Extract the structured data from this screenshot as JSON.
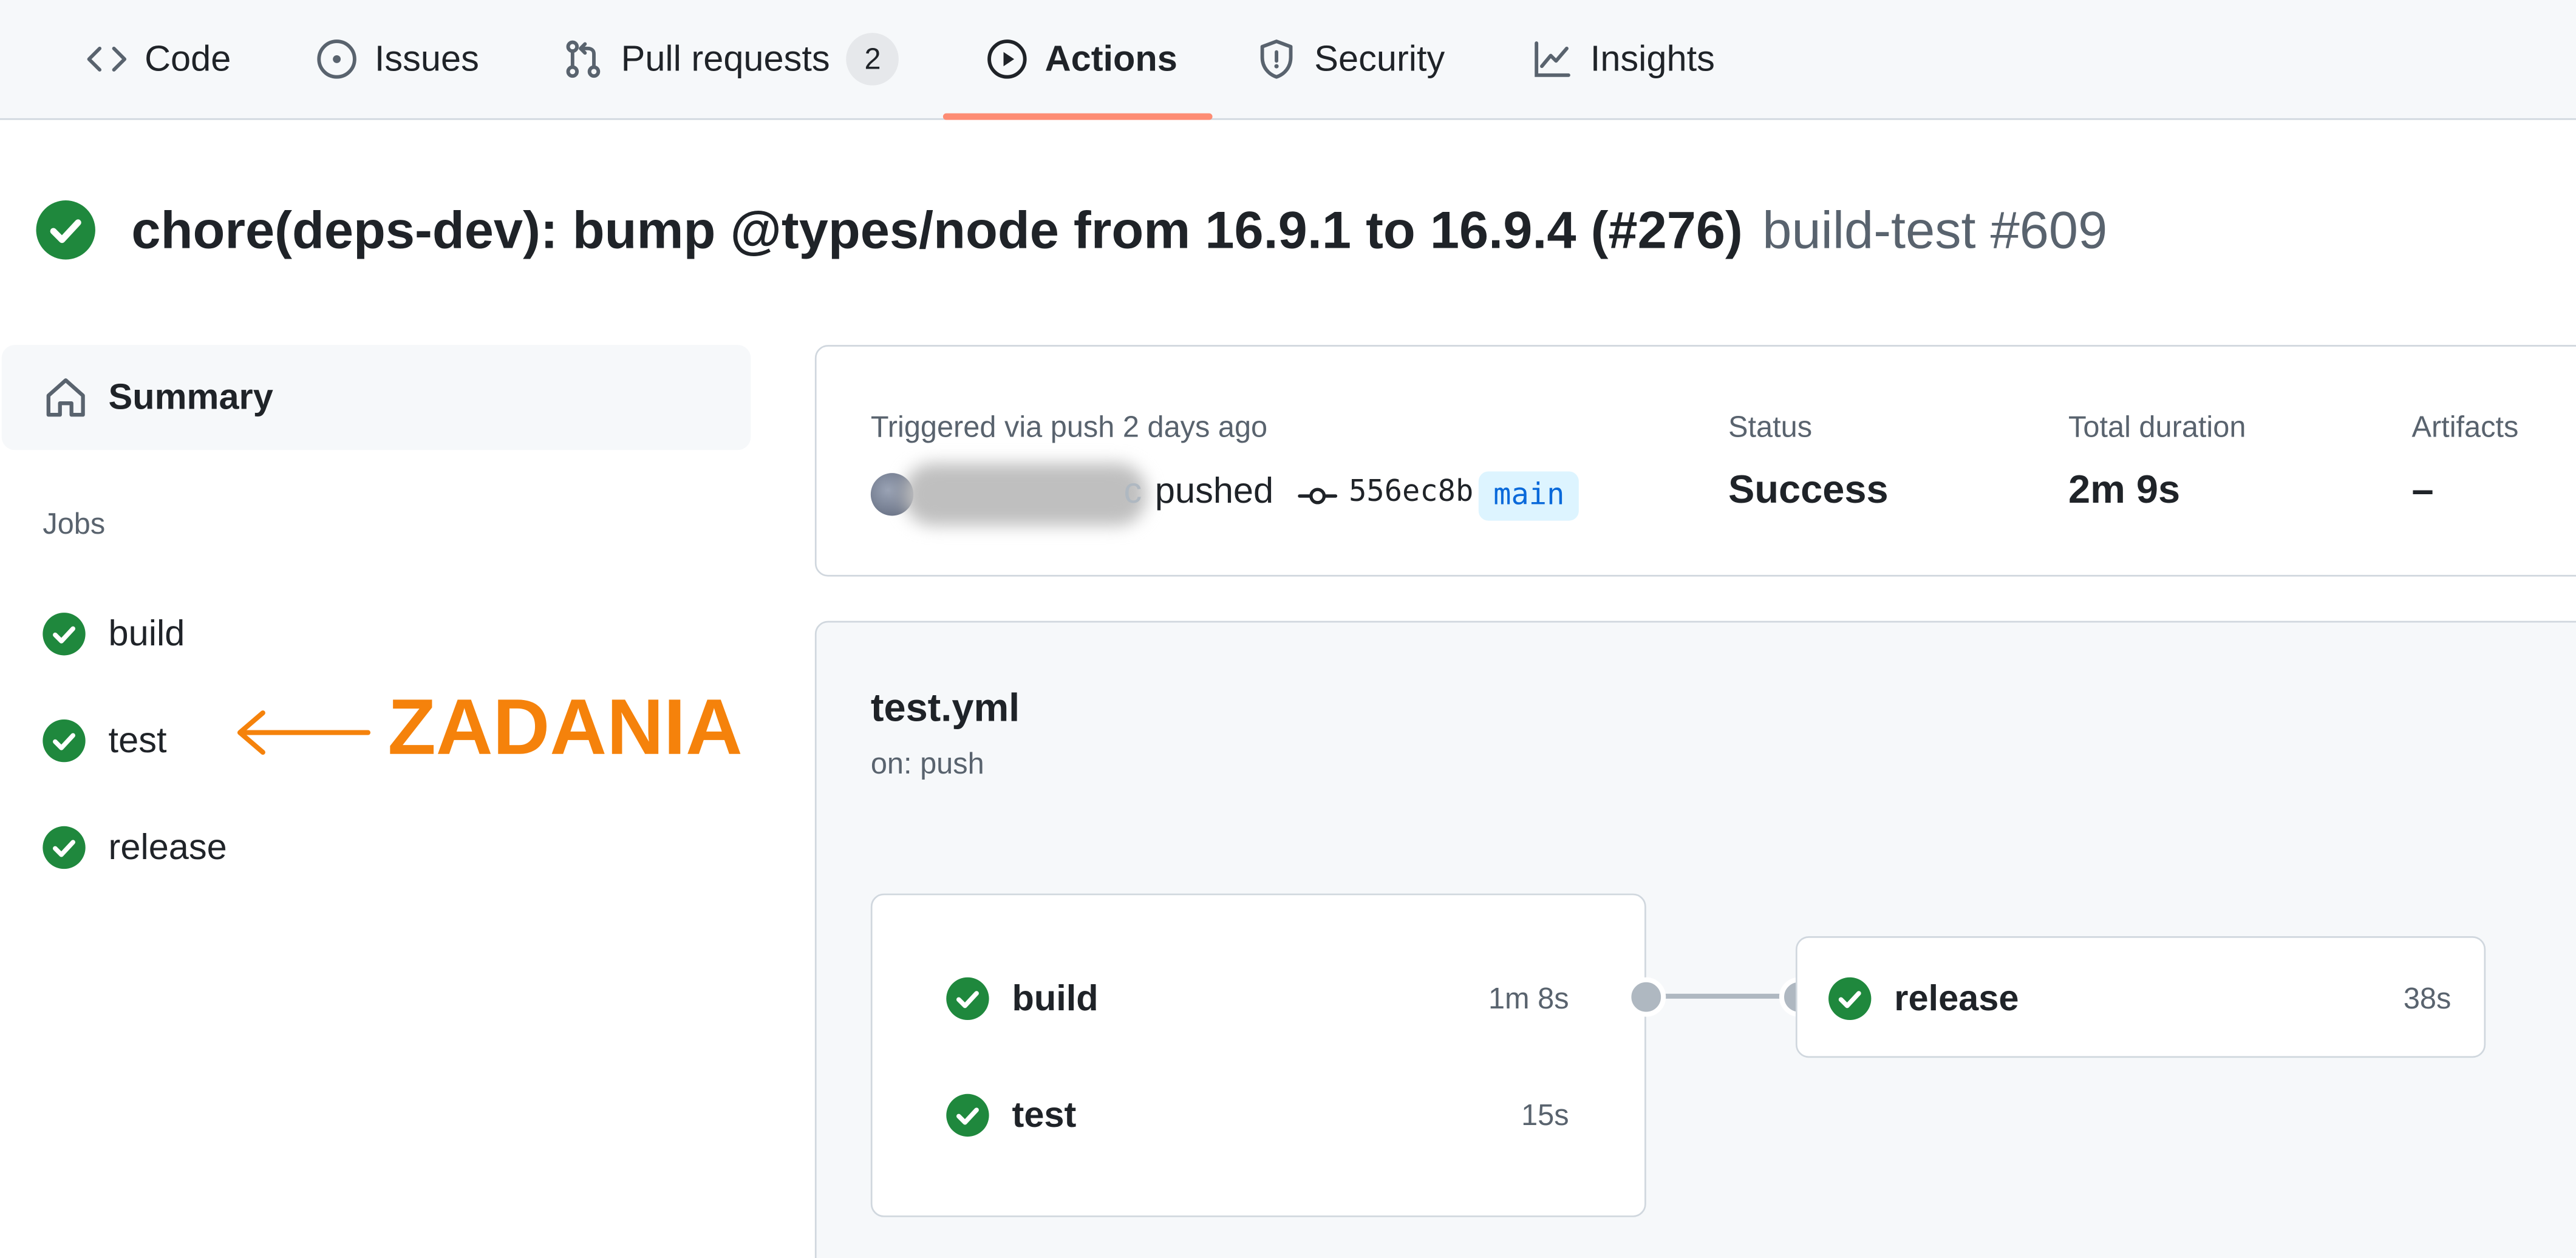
{
  "nav": {
    "tabs": [
      {
        "label": "Code",
        "icon": "code-icon"
      },
      {
        "label": "Issues",
        "icon": "issue-opened-icon"
      },
      {
        "label": "Pull requests",
        "icon": "git-pull-request-icon",
        "count": "2"
      },
      {
        "label": "Actions",
        "icon": "play-icon",
        "active": true
      },
      {
        "label": "Security",
        "icon": "shield-icon"
      },
      {
        "label": "Insights",
        "icon": "graph-icon"
      }
    ]
  },
  "run": {
    "title": "chore(deps-dev): bump @types/node from 16.9.1 to 16.9.4 (#276)",
    "suffix": "build-test #609",
    "status_icon": "check-circle-icon"
  },
  "sidebar": {
    "summary_label": "Summary",
    "summary_icon": "home-icon",
    "jobs_heading": "Jobs",
    "jobs": [
      {
        "label": "build"
      },
      {
        "label": "test"
      },
      {
        "label": "release"
      }
    ]
  },
  "annotation": {
    "text": "ZADANIA",
    "color": "#f5820b"
  },
  "summary": {
    "triggered_text": "Triggered via push 2 days ago",
    "actor_suffix": "c",
    "pushed_text": "pushed",
    "commit_sha": "556ec8b",
    "branch": "main",
    "status_label": "Status",
    "status_value": "Success",
    "duration_label": "Total duration",
    "duration_value": "2m 9s",
    "artifacts_label": "Artifacts",
    "artifacts_value": "–"
  },
  "workflow": {
    "file": "test.yml",
    "trigger": "on: push",
    "group_jobs": [
      {
        "name": "build",
        "duration": "1m 8s"
      },
      {
        "name": "test",
        "duration": "15s"
      }
    ],
    "downstream_job": {
      "name": "release",
      "duration": "38s"
    }
  },
  "colors": {
    "success": "#1f883d",
    "active_tab_underline": "#fd8c73",
    "branch_bg": "#ddf4ff",
    "branch_fg": "#0969da"
  }
}
